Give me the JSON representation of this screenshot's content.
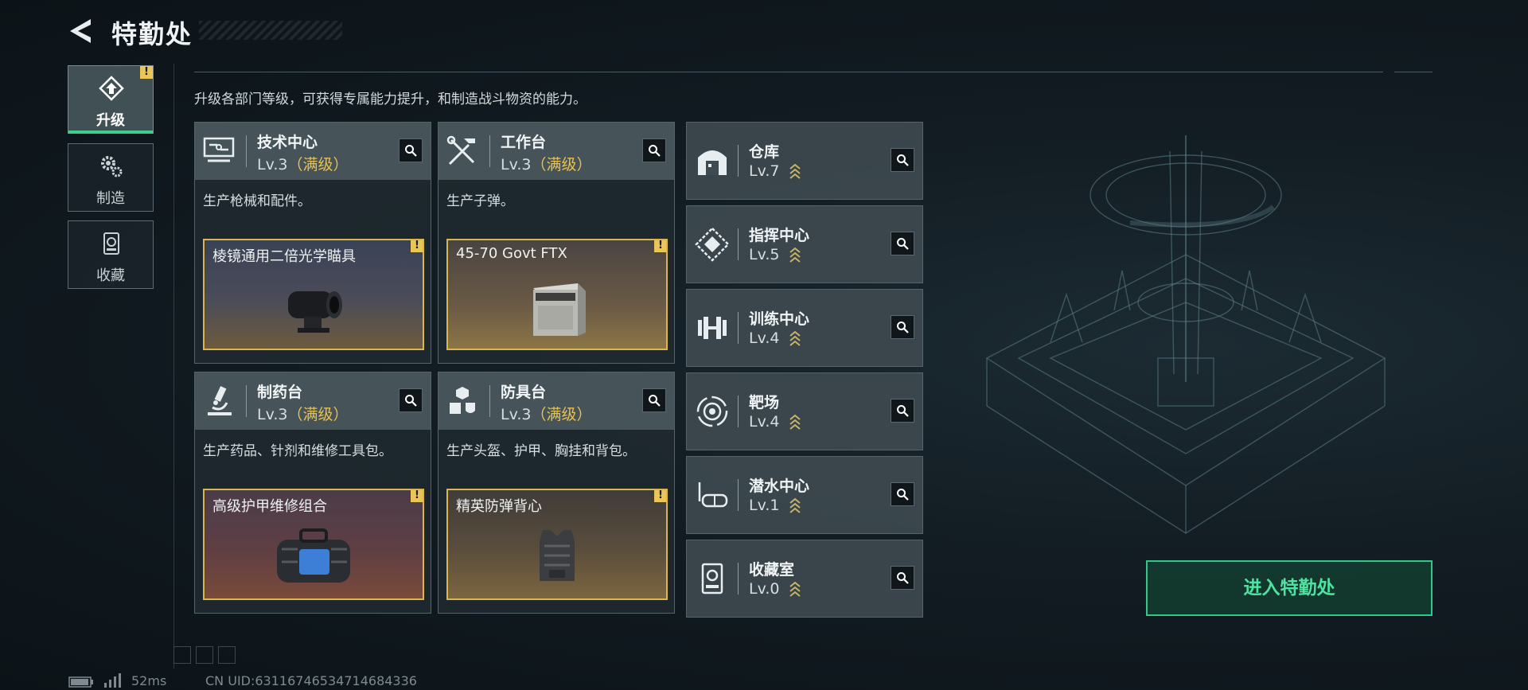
{
  "header": {
    "title": "特勤处"
  },
  "nav": [
    {
      "label": "升级",
      "icon": "upgrade-icon",
      "active": true,
      "badge": "!"
    },
    {
      "label": "制造",
      "icon": "gears-icon",
      "active": false
    },
    {
      "label": "收藏",
      "icon": "collection-icon",
      "active": false
    }
  ],
  "description": "升级各部门等级，可获得专属能力提升，和制造战斗物资的能力。",
  "departments": [
    {
      "name": "技术中心",
      "level": "Lv.3",
      "max": "（满级）",
      "desc": "生产枪械和配件。",
      "item": "棱镜通用二倍光学瞄具",
      "item_badge": "!",
      "icon": "computer-icon"
    },
    {
      "name": "工作台",
      "level": "Lv.3",
      "max": "（满级）",
      "desc": "生产子弹。",
      "item": "45-70 Govt FTX",
      "item_badge": "!",
      "icon": "tools-icon"
    },
    {
      "name": "制药台",
      "level": "Lv.3",
      "max": "（满级）",
      "desc": "生产药品、针剂和维修工具包。",
      "item": "高级护甲维修组合",
      "item_badge": "!",
      "icon": "microscope-icon"
    },
    {
      "name": "防具台",
      "level": "Lv.3",
      "max": "（满级）",
      "desc": "生产头盔、护甲、胸挂和背包。",
      "item": "精英防弹背心",
      "item_badge": "!",
      "icon": "armor-parts-icon"
    }
  ],
  "facilities": [
    {
      "name": "仓库",
      "level": "Lv.7",
      "icon": "warehouse-icon"
    },
    {
      "name": "指挥中心",
      "level": "Lv.5",
      "icon": "command-icon"
    },
    {
      "name": "训练中心",
      "level": "Lv.4",
      "icon": "dumbbell-icon"
    },
    {
      "name": "靶场",
      "level": "Lv.4",
      "icon": "target-icon"
    },
    {
      "name": "潜水中心",
      "level": "Lv.1",
      "icon": "diving-mask-icon"
    },
    {
      "name": "收藏室",
      "level": "Lv.0",
      "icon": "collection-room-icon"
    }
  ],
  "enter_button": "进入特勤处",
  "status": {
    "ping": "52ms",
    "uid": "CN UID:63116746534714684336"
  },
  "colors": {
    "accent_green": "#2fca88",
    "max_gold": "#e9c14f",
    "item_border": "#d9b650"
  }
}
